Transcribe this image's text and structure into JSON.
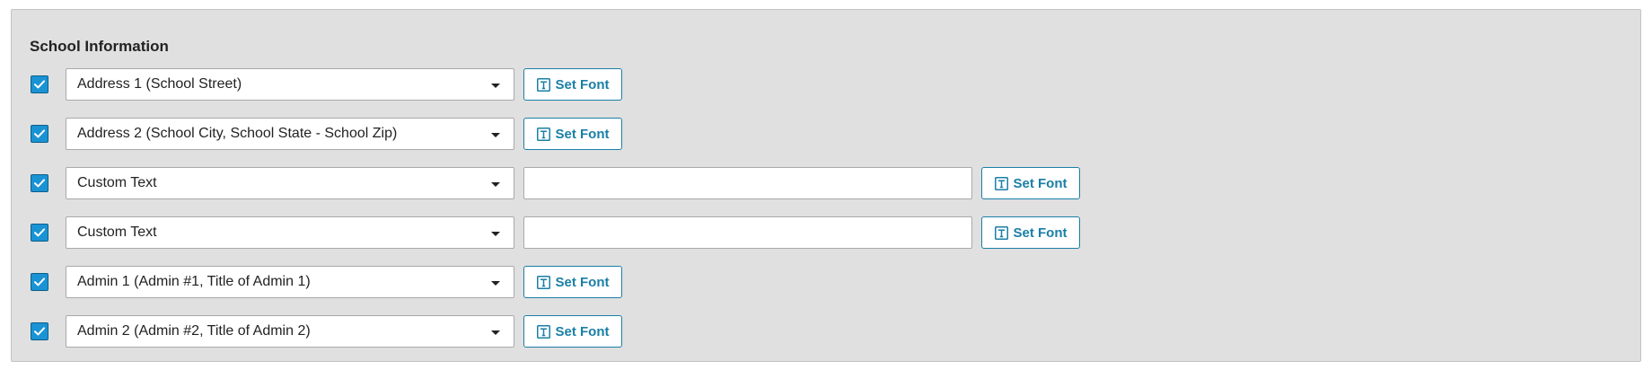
{
  "section": {
    "title": "School Information"
  },
  "rows": [
    {
      "checked": true,
      "select_value": "Address 1 (School Street)",
      "has_text_input": false,
      "text_value": "",
      "button_label": "Set Font"
    },
    {
      "checked": true,
      "select_value": "Address 2 (School City, School State - School Zip)",
      "has_text_input": false,
      "text_value": "",
      "button_label": "Set Font"
    },
    {
      "checked": true,
      "select_value": "Custom Text",
      "has_text_input": true,
      "text_value": "",
      "button_label": "Set Font"
    },
    {
      "checked": true,
      "select_value": "Custom Text",
      "has_text_input": true,
      "text_value": "",
      "button_label": "Set Font"
    },
    {
      "checked": true,
      "select_value": "Admin 1 (Admin #1, Title of Admin 1)",
      "has_text_input": false,
      "text_value": "",
      "button_label": "Set Font"
    },
    {
      "checked": true,
      "select_value": "Admin 2 (Admin #2, Title of Admin 2)",
      "has_text_input": false,
      "text_value": "",
      "button_label": "Set Font"
    }
  ],
  "icons": {
    "checkbox": "checkmark-icon",
    "select": "chevron-down-icon",
    "button": "text-font-icon"
  },
  "colors": {
    "accent": "#1a7fa6",
    "checkbox_fill": "#1a93d4",
    "panel_background": "#e0e0e0"
  }
}
